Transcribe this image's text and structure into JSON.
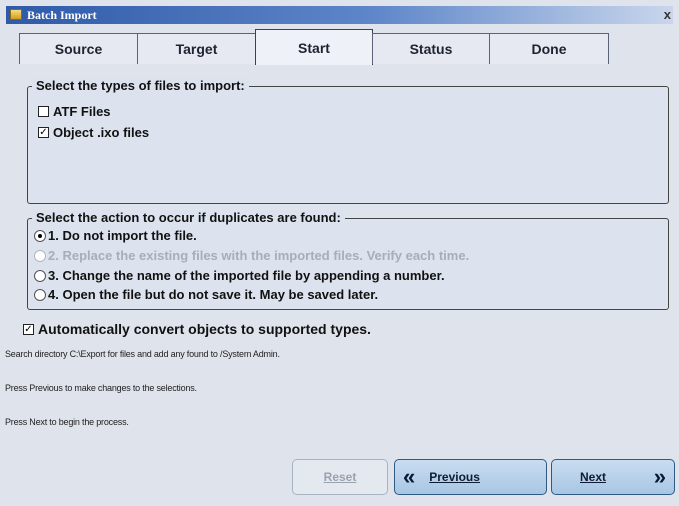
{
  "window": {
    "title": "Batch Import",
    "close_glyph": "x"
  },
  "tabs": [
    {
      "label": "Source",
      "active": false
    },
    {
      "label": "Target",
      "active": false
    },
    {
      "label": "Start",
      "active": true
    },
    {
      "label": "Status",
      "active": false
    },
    {
      "label": "Done",
      "active": false
    }
  ],
  "file_types": {
    "legend": "Select the types of files to import:",
    "options": [
      {
        "label": "ATF Files",
        "checked": false
      },
      {
        "label": "Object .ixo files",
        "checked": true
      }
    ]
  },
  "duplicates": {
    "legend": "Select the action to occur if duplicates are found:",
    "options": [
      {
        "label": "1. Do not import the file.",
        "selected": true,
        "enabled": true
      },
      {
        "label": "2. Replace the existing files with the imported files. Verify each time.",
        "selected": false,
        "enabled": false
      },
      {
        "label": "3. Change the name of the imported file by appending a number.",
        "selected": false,
        "enabled": true
      },
      {
        "label": "4. Open the file but do not save it. May be saved later.",
        "selected": false,
        "enabled": true
      }
    ]
  },
  "auto_convert": {
    "label": "Automatically convert objects to supported types.",
    "checked": true
  },
  "info": [
    "Search directory C:\\Export for files and add any found to /System Admin.",
    "Press Previous to make changes to the selections.",
    "Press Next to begin the process."
  ],
  "buttons": {
    "reset": {
      "label": "Reset",
      "enabled": false
    },
    "previous": {
      "label": "Previous",
      "enabled": true
    },
    "next": {
      "label": "Next",
      "enabled": true
    }
  },
  "icons": {
    "previous": "double-chevron-left-icon",
    "next": "double-chevron-right-icon",
    "app": "folder-icon"
  },
  "colors": {
    "titlebar": "#2f5aa8",
    "panel": "#dde3ee",
    "button": "#b8d2ec"
  }
}
